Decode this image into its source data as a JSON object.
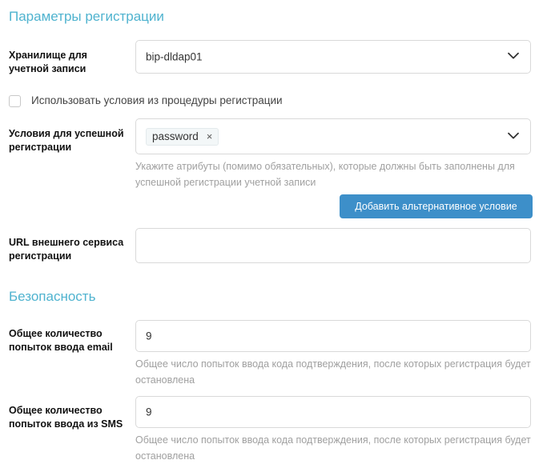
{
  "registration": {
    "title": "Параметры регистрации",
    "storage_label": "Хранилище для учетной записи",
    "storage_value": "bip-dldap01",
    "use_conditions_label": "Использовать условия из процедуры регистрации",
    "conditions_label": "Условия для успешной регистрации",
    "conditions_tags": [
      "password"
    ],
    "conditions_hint": "Укажите атрибуты (помимо обязательных), которые должны быть заполнены для успешной регистрации учетной записи",
    "add_condition_button": "Добавить альтернативное условие",
    "external_url_label": "URL внешнего сервиса регистрации",
    "external_url_value": ""
  },
  "security": {
    "title": "Безопасность",
    "email_attempts_label": "Общее количество попыток ввода email",
    "email_attempts_value": "9",
    "email_attempts_hint": "Общее число попыток ввода кода подтверждения, после которых регистрация будет остановлена",
    "sms_attempts_label": "Общее количество попыток ввода из SMS",
    "sms_attempts_value": "9",
    "sms_attempts_hint": "Общее число попыток ввода кода подтверждения, после которых регистрация будет остановлена"
  },
  "colors": {
    "accent": "#4fb3cf",
    "button": "#3d8fc9",
    "hint": "#a0a0a0"
  },
  "icons": {
    "dropdown": "chevron-down-icon",
    "remove_tag": "close-icon"
  }
}
